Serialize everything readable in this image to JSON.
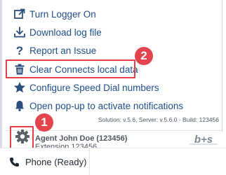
{
  "menu": {
    "items": [
      {
        "label": "Turn Logger On",
        "icon": "external-link-icon"
      },
      {
        "label": "Download log file",
        "icon": "download-icon"
      },
      {
        "label": "Report an Issue",
        "icon": "question-mark-icon"
      },
      {
        "label": "Clear Connects local data",
        "icon": "trash-icon"
      },
      {
        "label": "Configure Speed Dial numbers",
        "icon": "star-icon"
      },
      {
        "label": "Open pop-up to activate notifications",
        "icon": "bell-icon"
      }
    ]
  },
  "footer": {
    "version": "Solution: v.5.6, Server: v.5.6.0 - Build: 123456",
    "agent_name": "Agent John Doe (123456)",
    "extension": "Extension 123456",
    "logo_text": "b+s"
  },
  "callouts": {
    "one": "1",
    "two": "2"
  },
  "status_bar": {
    "phone_label": "Phone (Ready)"
  },
  "colors": {
    "link": "#1f4e8a",
    "icon": "#2b4f7d",
    "highlight": "#e63e46",
    "callout": "#e4444b"
  }
}
